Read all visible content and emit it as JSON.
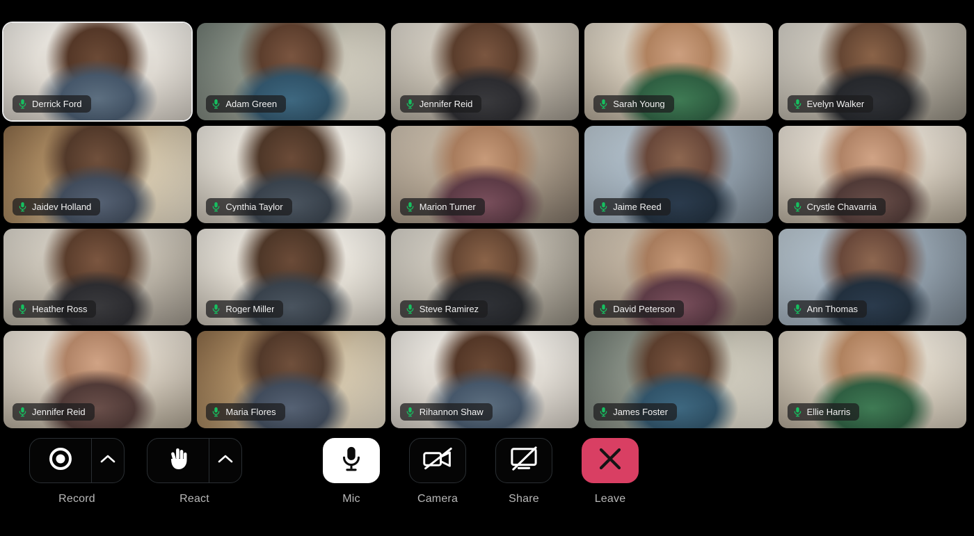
{
  "meeting": {
    "layout": "grid",
    "columns": 5,
    "rows": 4,
    "participant_count": 20,
    "background_color": "#000000"
  },
  "participants": [
    {
      "name": "Derrick Ford",
      "mic": "mic-on-icon",
      "mic_color": "#16c060",
      "speaking": true,
      "scene": "room-a"
    },
    {
      "name": "Adam Green",
      "mic": "mic-on-icon",
      "mic_color": "#16c060",
      "speaking": false,
      "scene": "room-b"
    },
    {
      "name": "Jennifer Reid",
      "mic": "mic-on-icon",
      "mic_color": "#16c060",
      "speaking": false,
      "scene": "room-c"
    },
    {
      "name": "Sarah Young",
      "mic": "mic-on-icon",
      "mic_color": "#16c060",
      "speaking": false,
      "scene": "room-d"
    },
    {
      "name": "Evelyn Walker",
      "mic": "mic-on-icon",
      "mic_color": "#16c060",
      "speaking": false,
      "scene": "room-e"
    },
    {
      "name": "Jaidev Holland",
      "mic": "mic-on-icon",
      "mic_color": "#16c060",
      "speaking": false,
      "scene": "room-f"
    },
    {
      "name": "Cynthia Taylor",
      "mic": "mic-on-icon",
      "mic_color": "#16c060",
      "speaking": false,
      "scene": "room-g"
    },
    {
      "name": "Marion Turner",
      "mic": "mic-on-icon",
      "mic_color": "#16c060",
      "speaking": false,
      "scene": "room-h"
    },
    {
      "name": "Jaime Reed",
      "mic": "mic-on-icon",
      "mic_color": "#16c060",
      "speaking": false,
      "scene": "room-i"
    },
    {
      "name": "Crystle Chavarria",
      "mic": "mic-on-icon",
      "mic_color": "#16c060",
      "speaking": false,
      "scene": "room-j"
    },
    {
      "name": "Heather Ross",
      "mic": "mic-on-icon",
      "mic_color": "#16c060",
      "speaking": false,
      "scene": "room-c"
    },
    {
      "name": "Roger Miller",
      "mic": "mic-on-icon",
      "mic_color": "#16c060",
      "speaking": false,
      "scene": "room-g"
    },
    {
      "name": "Steve Ramirez",
      "mic": "mic-on-icon",
      "mic_color": "#16c060",
      "speaking": false,
      "scene": "room-e"
    },
    {
      "name": "David Peterson",
      "mic": "mic-on-icon",
      "mic_color": "#16c060",
      "speaking": false,
      "scene": "room-h"
    },
    {
      "name": "Ann Thomas",
      "mic": "mic-on-icon",
      "mic_color": "#16c060",
      "speaking": false,
      "scene": "room-i"
    },
    {
      "name": "Jennifer Reid",
      "mic": "mic-on-icon",
      "mic_color": "#16c060",
      "speaking": false,
      "scene": "room-j"
    },
    {
      "name": "Maria Flores",
      "mic": "mic-on-icon",
      "mic_color": "#16c060",
      "speaking": false,
      "scene": "room-f"
    },
    {
      "name": "Rihannon Shaw",
      "mic": "mic-on-icon",
      "mic_color": "#16c060",
      "speaking": false,
      "scene": "room-a"
    },
    {
      "name": "James Foster",
      "mic": "mic-on-icon",
      "mic_color": "#16c060",
      "speaking": false,
      "scene": "room-b"
    },
    {
      "name": "Ellie Harris",
      "mic": "mic-on-icon",
      "mic_color": "#16c060",
      "speaking": false,
      "scene": "room-d"
    }
  ],
  "toolbar": {
    "record": {
      "label": "Record",
      "icon": "record-circle-icon",
      "caret_icon": "chevron-up-icon",
      "state": "idle"
    },
    "react": {
      "label": "React",
      "icon": "raised-hand-icon",
      "caret_icon": "chevron-up-icon",
      "state": "idle"
    },
    "mic": {
      "label": "Mic",
      "icon": "microphone-icon",
      "state": "on",
      "background": "#ffffff",
      "foreground": "#0b0b0b"
    },
    "camera": {
      "label": "Camera",
      "icon": "video-camera-off-icon",
      "state": "off"
    },
    "share": {
      "label": "Share",
      "icon": "screen-share-off-icon",
      "state": "off"
    },
    "leave": {
      "label": "Leave",
      "icon": "close-x-icon",
      "background": "#d93f63",
      "foreground": "#141414"
    }
  }
}
